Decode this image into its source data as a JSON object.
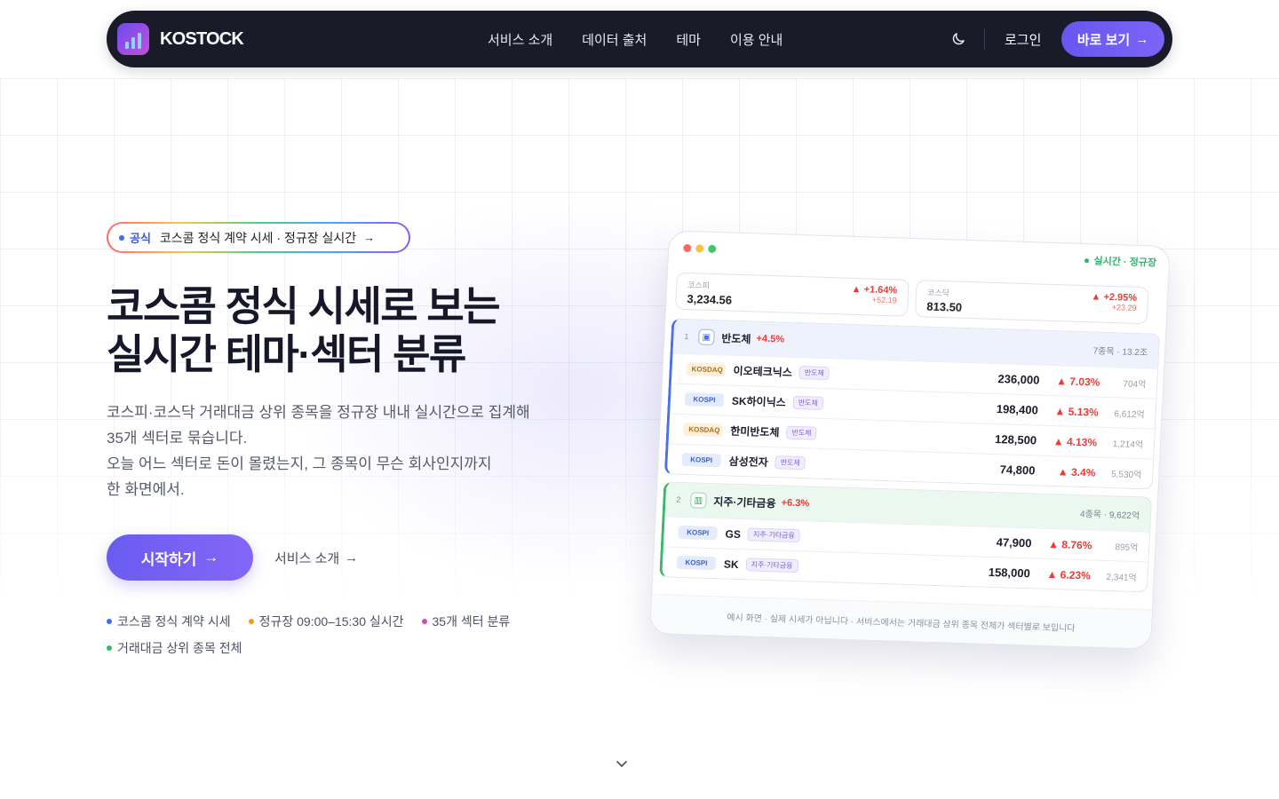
{
  "nav": {
    "brand": "KOSTOCK",
    "menu": [
      "서비스 소개",
      "데이터 출처",
      "테마",
      "이용 안내"
    ],
    "login": "로그인",
    "cta": "바로 보기"
  },
  "hero": {
    "pill_tag": "공식",
    "pill_text": "코스콤 정식 계약 시세 · 정규장 실시간",
    "title_line1": "코스콤 정식 시세로 보는",
    "title_line2": "실시간 테마·섹터 분류",
    "desc": [
      "코스피·코스닥 거래대금 상위 종목을 정규장 내내 실시간으로 집계해",
      "35개 섹터로 묶습니다.",
      "오늘 어느 섹터로 돈이 몰렸는지, 그 종목이 무슨 회사인지까지",
      "한 화면에서."
    ],
    "start": "시작하기",
    "about": "서비스 소개",
    "features": [
      {
        "text": "코스콤 정식 계약 시세",
        "color": "#3b6ff0"
      },
      {
        "text": "정규장 09:00–15:30 실시간",
        "color": "#f39a1e"
      },
      {
        "text": "35개 섹터 분류",
        "color": "#d44bb0"
      },
      {
        "text": "거래대금 상위 종목 전체",
        "color": "#36b865"
      }
    ]
  },
  "card": {
    "live": "실시간 · 정규장",
    "indices": [
      {
        "name": "코스피",
        "value": "3,234.56",
        "change": "▲ +1.64%",
        "delta": "+52.19"
      },
      {
        "name": "코스닥",
        "value": "813.50",
        "change": "▲ +2.95%",
        "delta": "+23.29"
      }
    ],
    "sectors": [
      {
        "no": "1",
        "name": "반도체",
        "pct": "+4.5%",
        "meta": "7종목 · 13.2조",
        "rows": [
          {
            "market": "KOSDAQ",
            "name": "이오테크닉스",
            "tag": "반도체",
            "price": "236,000",
            "chg": "▲ 7.03%",
            "vol": "704억"
          },
          {
            "market": "KOSPI",
            "name": "SK하이닉스",
            "tag": "반도체",
            "price": "198,400",
            "chg": "▲ 5.13%",
            "vol": "6,612억"
          },
          {
            "market": "KOSDAQ",
            "name": "한미반도체",
            "tag": "반도체",
            "price": "128,500",
            "chg": "▲ 4.13%",
            "vol": "1,214억"
          },
          {
            "market": "KOSPI",
            "name": "삼성전자",
            "tag": "반도체",
            "price": "74,800",
            "chg": "▲ 3.4%",
            "vol": "5,530억"
          }
        ]
      },
      {
        "no": "2",
        "name": "지주·기타금융",
        "pct": "+6.3%",
        "meta": "4종목 · 9,622억",
        "rows": [
          {
            "market": "KOSPI",
            "name": "GS",
            "tag": "지주·기타금융",
            "price": "47,900",
            "chg": "▲ 8.76%",
            "vol": "895억"
          },
          {
            "market": "KOSPI",
            "name": "SK",
            "tag": "지주·기타금융",
            "price": "158,000",
            "chg": "▲ 6.23%",
            "vol": "2,341억"
          }
        ]
      }
    ],
    "footer": "예시 화면 · 실제 시세가 아닙니다 · 서비스에서는 거래대금 상위 종목 전체가 섹터별로 보입니다"
  }
}
